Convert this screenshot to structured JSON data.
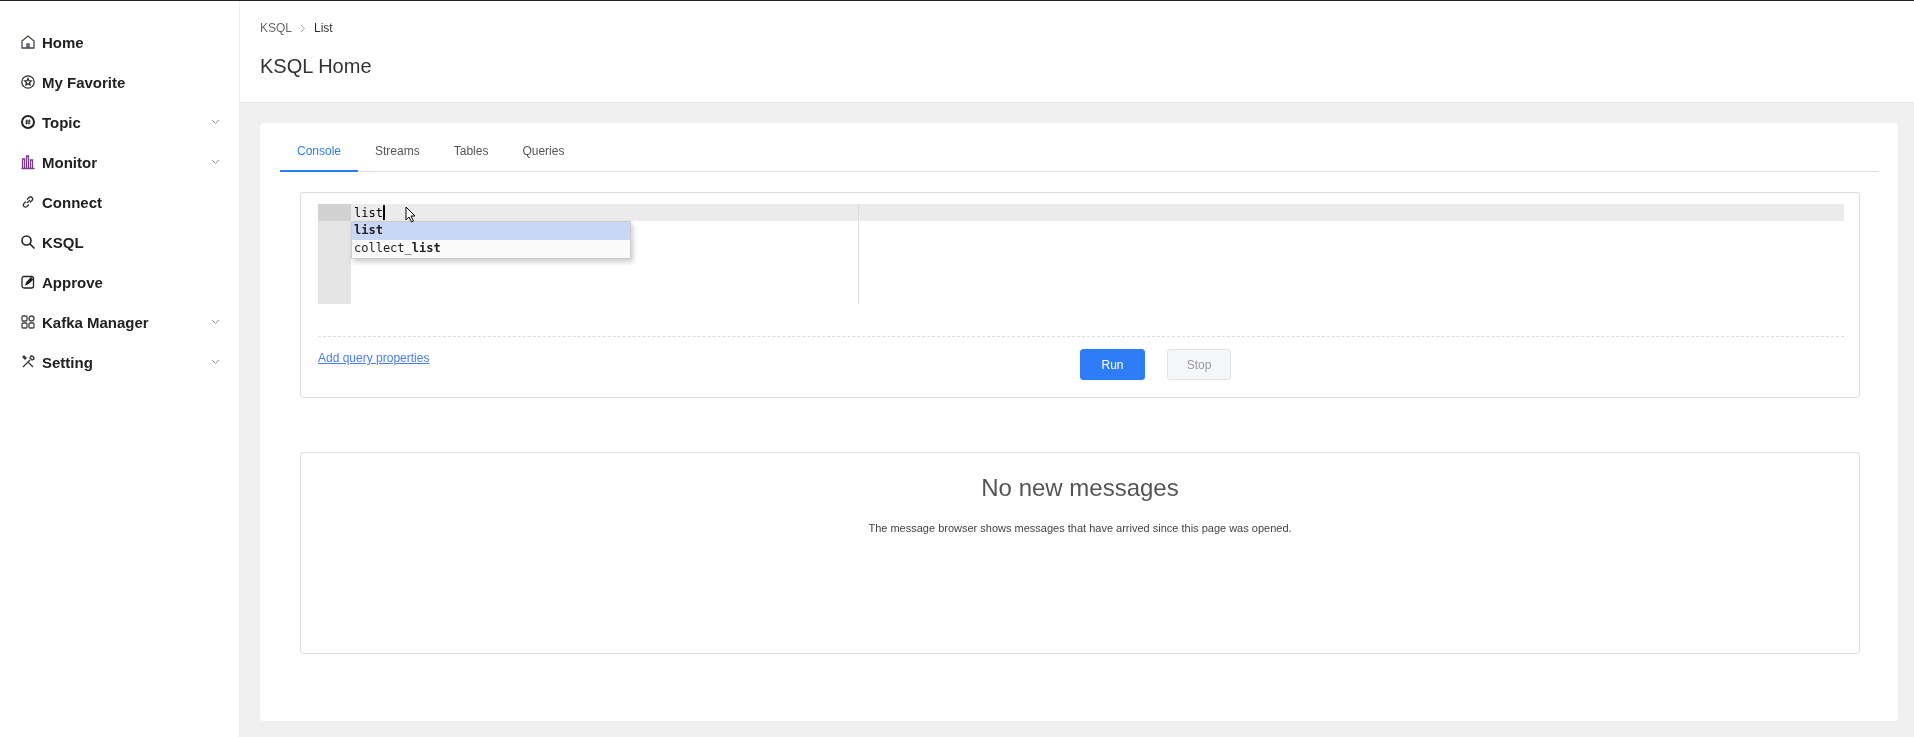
{
  "sidebar": {
    "items": [
      {
        "label": "Home",
        "expandable": false
      },
      {
        "label": "My Favorite",
        "expandable": false
      },
      {
        "label": "Topic",
        "expandable": true
      },
      {
        "label": "Monitor",
        "expandable": true
      },
      {
        "label": "Connect",
        "expandable": false
      },
      {
        "label": "KSQL",
        "expandable": false
      },
      {
        "label": "Approve",
        "expandable": false
      },
      {
        "label": "Kafka Manager",
        "expandable": true
      },
      {
        "label": "Setting",
        "expandable": true
      }
    ]
  },
  "breadcrumb": [
    "KSQL",
    "List"
  ],
  "page_title": "KSQL Home",
  "tabs": [
    {
      "label": "Console",
      "selected": true
    },
    {
      "label": "Streams",
      "selected": false
    },
    {
      "label": "Tables",
      "selected": false
    },
    {
      "label": "Queries",
      "selected": false
    }
  ],
  "editor": {
    "value": "list",
    "suggestions": [
      {
        "text": "**list**",
        "selected": true
      },
      {
        "text": "collect_**list**",
        "selected": false
      }
    ]
  },
  "add_properties_link": "Add query properties",
  "buttons": [
    {
      "label": "Run",
      "disabled": false
    },
    {
      "label": "Stop",
      "disabled": true
    }
  ],
  "messages": {
    "title": "No new messages",
    "description": "The message browser shows messages that have arrived since this page was opened."
  }
}
